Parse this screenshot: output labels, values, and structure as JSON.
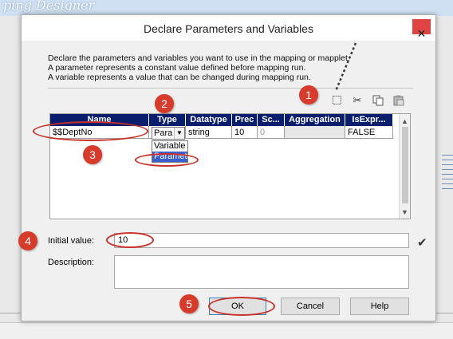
{
  "background_app": {
    "title": "ping Designer"
  },
  "dialog": {
    "title": "Declare Parameters and Variables",
    "close_glyph": "✕",
    "description_lines": [
      "Declare the parameters and variables you want to use in the mapping or mapplet.",
      "A parameter represents a constant value defined before mapping run.",
      "A variable represents a value that can be changed during mapping run."
    ],
    "toolbar": {
      "add_icon": "new-row-icon",
      "cut_icon": "scissors-icon",
      "copy_icon": "copy-icon",
      "paste_icon": "paste-icon"
    },
    "grid": {
      "headers": [
        "Name",
        "Type",
        "Datatype",
        "Prec",
        "Sc...",
        "Aggregation",
        "IsExpr..."
      ],
      "row": {
        "name": "$$DeptNo",
        "type": "Para",
        "datatype": "string",
        "prec": "10",
        "scale": "0",
        "aggregation": "",
        "is_expr": "FALSE"
      },
      "type_options": [
        "Variable",
        "Parameter"
      ],
      "type_selected": "Parameter"
    },
    "initial_value_label": "Initial value:",
    "initial_value": "10",
    "description_label": "Description:",
    "description_value": "",
    "buttons": {
      "ok": "OK",
      "cancel": "Cancel",
      "help": "Help"
    }
  },
  "annotations": {
    "steps": [
      "1",
      "2",
      "3",
      "4",
      "5"
    ],
    "color": "#d63b2c"
  }
}
